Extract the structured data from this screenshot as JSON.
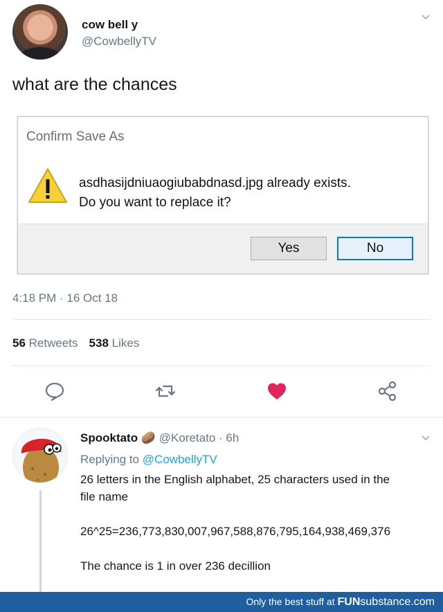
{
  "tweet": {
    "name": "cow bell y",
    "handle": "@CowbellyTV",
    "text": "what are the chances",
    "timestamp": "4:18 PM · 16 Oct 18",
    "retweets_count": "56",
    "retweets_label": "Retweets",
    "likes_count": "538",
    "likes_label": "Likes"
  },
  "dialog": {
    "title": "Confirm Save As",
    "message_line1": "asdhasijdniuaogiubabdnasd.jpg already exists.",
    "message_line2": "Do you want to replace it?",
    "yes_label": "Yes",
    "no_label": "No"
  },
  "actions": {
    "reply_icon": "reply-icon",
    "retweet_icon": "retweet-icon",
    "like_icon": "heart-icon",
    "share_icon": "share-icon",
    "like_color": "#e0245e"
  },
  "reply": {
    "name": "Spooktato",
    "emoji": "🥔",
    "handle": "@Koretato",
    "age": "· 6h",
    "replying_prefix": "Replying to",
    "replying_to": "@CowbellyTV",
    "line1": "26 letters in the English alphabet, 25 characters used in the",
    "line2": "file name",
    "line3": "26^25=236,773,830,007,967,588,876,795,164,938,469,376",
    "line4": "The chance is 1 in over 236 decillion"
  },
  "banner": {
    "prefix": "Only the best stuff at",
    "brand_bold": "FUN",
    "brand_rest": "substance.com"
  },
  "colors": {
    "link": "#1da1f2",
    "muted": "#657786",
    "banner_bg": "#1f5fa0"
  }
}
